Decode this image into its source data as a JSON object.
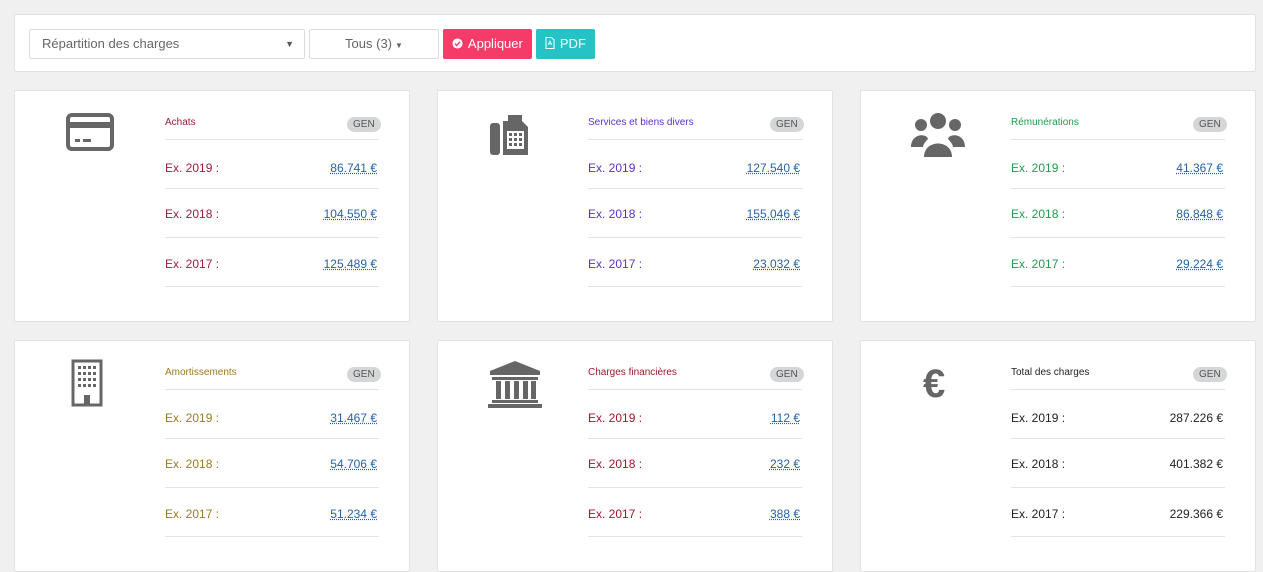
{
  "toolbar": {
    "select_value": "Répartition des charges",
    "filter_label": "Tous (3)",
    "apply_label": "Appliquer",
    "pdf_label": "PDF"
  },
  "colors": {
    "achats": "#9a1d3c",
    "services": "#5a2fd0",
    "remunerations": "#1f9d4d",
    "amortissements": "#9b7b1d",
    "charges_financieres": "#a01828",
    "total": "#222222",
    "apply_button": "#f53b68",
    "pdf_button": "#26c3c6"
  },
  "cards": [
    {
      "title": "Achats",
      "badge": "GEN",
      "icon": "credit-card-icon",
      "rows": [
        {
          "label": "Ex. 2019 :",
          "value": "86.741 €"
        },
        {
          "label": "Ex. 2018 :",
          "value": "104.550 €"
        },
        {
          "label": "Ex. 2017 :",
          "value": "125.489 €"
        }
      ]
    },
    {
      "title": "Services et biens divers",
      "badge": "GEN",
      "icon": "fax-icon",
      "rows": [
        {
          "label": "Ex. 2019 :",
          "value": "127.540 €"
        },
        {
          "label": "Ex. 2018 :",
          "value": "155.046 €"
        },
        {
          "label": "Ex. 2017 :",
          "value": "23.032 €"
        }
      ]
    },
    {
      "title": "Rémunérations",
      "badge": "GEN",
      "icon": "users-icon",
      "rows": [
        {
          "label": "Ex. 2019 :",
          "value": "41.367 €"
        },
        {
          "label": "Ex. 2018 :",
          "value": "86.848 €"
        },
        {
          "label": "Ex. 2017 :",
          "value": "29.224 €"
        }
      ]
    },
    {
      "title": "Amortissements",
      "badge": "GEN",
      "icon": "building-icon",
      "rows": [
        {
          "label": "Ex. 2019 :",
          "value": "31.467 €"
        },
        {
          "label": "Ex. 2018 :",
          "value": "54.706 €"
        },
        {
          "label": "Ex. 2017 :",
          "value": "51.234 €"
        }
      ]
    },
    {
      "title": "Charges financières",
      "badge": "GEN",
      "icon": "bank-icon",
      "rows": [
        {
          "label": "Ex. 2019 :",
          "value": "112 €"
        },
        {
          "label": "Ex. 2018 :",
          "value": "232 €"
        },
        {
          "label": "Ex. 2017 :",
          "value": "388 €"
        }
      ]
    },
    {
      "title": "Total des charges",
      "badge": "GEN",
      "icon": "euro-icon",
      "rows": [
        {
          "label": "Ex. 2019 :",
          "value": "287.226 €"
        },
        {
          "label": "Ex. 2018 :",
          "value": "401.382 €"
        },
        {
          "label": "Ex. 2017 :",
          "value": "229.366 €"
        }
      ]
    }
  ]
}
